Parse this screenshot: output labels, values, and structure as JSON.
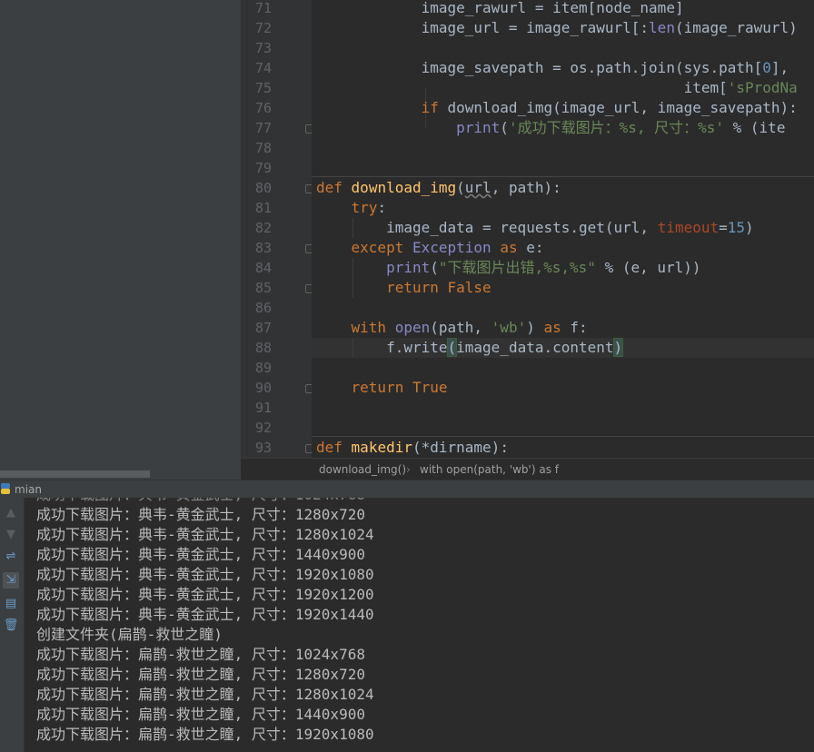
{
  "editor": {
    "line_numbers": [
      "71",
      "72",
      "73",
      "74",
      "75",
      "76",
      "77",
      "78",
      "79",
      "80",
      "81",
      "82",
      "83",
      "84",
      "85",
      "86",
      "87",
      "88",
      "89",
      "90",
      "91",
      "92",
      "93"
    ]
  },
  "breadcrumb": {
    "function": "download_img()",
    "separator": "›",
    "block": "with open(path, 'wb') as f"
  },
  "run_panel": {
    "tab_label": "mian",
    "output_lines": [
      "成功下载图片：典韦-黄金武士, 尺寸：1280x720",
      "成功下载图片：典韦-黄金武士, 尺寸：1280x1024",
      "成功下载图片：典韦-黄金武士, 尺寸：1440x900",
      "成功下载图片：典韦-黄金武士, 尺寸：1920x1080",
      "成功下载图片：典韦-黄金武士, 尺寸：1920x1200",
      "成功下载图片：典韦-黄金武士, 尺寸：1920x1440",
      "创建文件夹(扁鹊-救世之瞳)",
      "成功下载图片：扁鹊-救世之瞳, 尺寸：1024x768",
      "成功下载图片：扁鹊-救世之瞳, 尺寸：1280x720",
      "成功下载图片：扁鹊-救世之瞳, 尺寸：1280x1024",
      "成功下载图片：扁鹊-救世之瞳, 尺寸：1440x900",
      "成功下载图片：扁鹊-救世之瞳, 尺寸：1920x1080"
    ],
    "toolbar_icons": [
      "up-arrow-icon",
      "down-arrow-icon",
      "soft-wrap-icon",
      "scroll-to-end-icon",
      "print-icon",
      "trash-icon"
    ]
  },
  "colors": {
    "keyword": "#cc7832",
    "function_name": "#ffc66d",
    "builtin": "#8888c6",
    "string": "#6a8759",
    "number": "#6897bb",
    "default_text": "#a9b7c6",
    "background": "#2b2b2b"
  }
}
